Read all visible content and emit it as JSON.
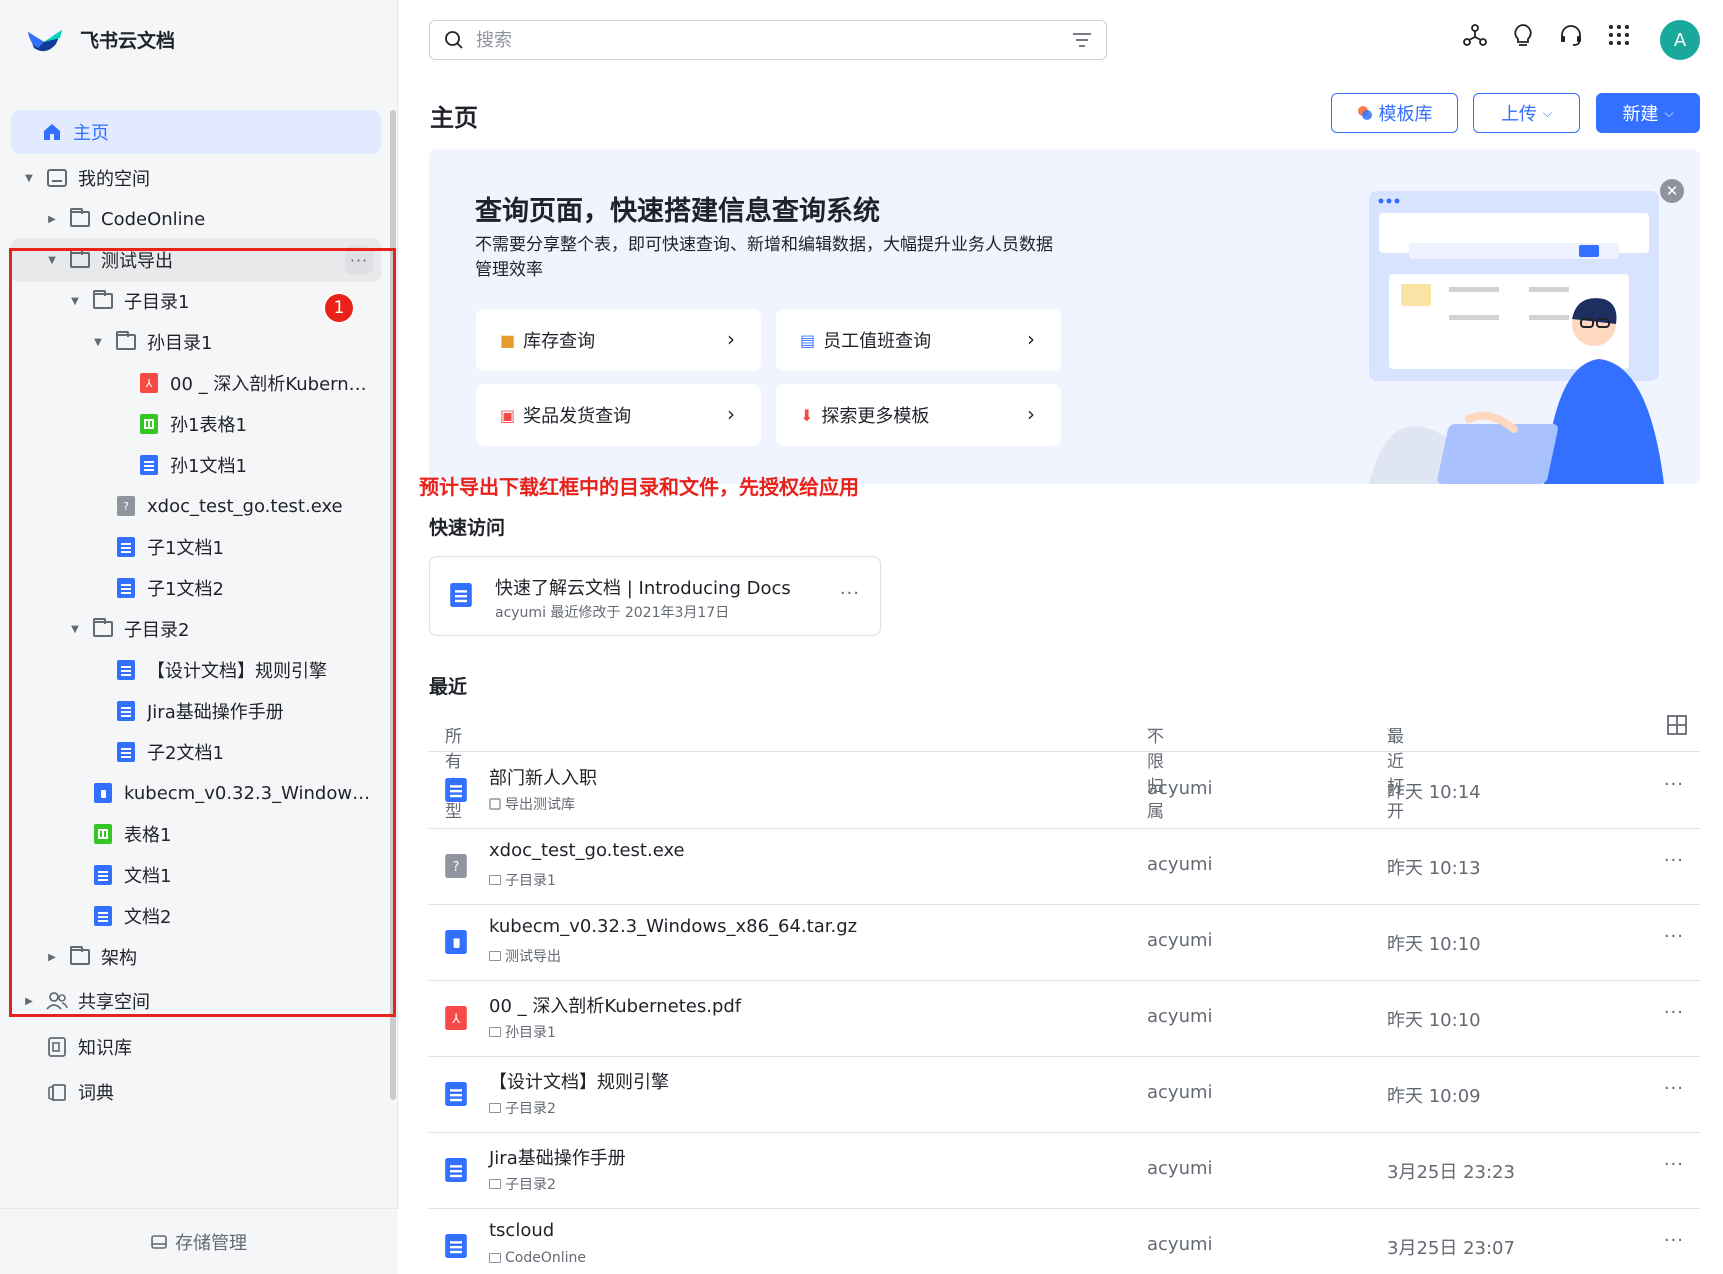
{
  "app": {
    "name": "飞书云文档"
  },
  "sidebar": {
    "home": "主页",
    "my_space": "我的空间",
    "tree": [
      {
        "label": "CodeOnline"
      },
      {
        "label": "测试导出"
      },
      {
        "label": "子目录1"
      },
      {
        "label": "孙目录1"
      },
      {
        "label": "00 _ 深入剖析Kubernet..."
      },
      {
        "label": "孙1表格1"
      },
      {
        "label": "孙1文档1"
      },
      {
        "label": "xdoc_test_go.test.exe"
      },
      {
        "label": "子1文档1"
      },
      {
        "label": "子1文档2"
      },
      {
        "label": "子目录2"
      },
      {
        "label": "【设计文档】规则引擎"
      },
      {
        "label": "Jira基础操作手册"
      },
      {
        "label": "子2文档1"
      },
      {
        "label": "kubecm_v0.32.3_Windows_x..."
      },
      {
        "label": "表格1"
      },
      {
        "label": "文档1"
      },
      {
        "label": "文档2"
      },
      {
        "label": "架构"
      }
    ],
    "shared_space": "共享空间",
    "wiki": "知识库",
    "dictionary": "词典",
    "storage": "存储管理",
    "badge": "1",
    "more_glyph": "···"
  },
  "search": {
    "placeholder": "搜索"
  },
  "user": {
    "avatar_letter": "A"
  },
  "header": {
    "title": "主页",
    "template_btn": "模板库",
    "upload_btn": "上传",
    "new_btn": "新建"
  },
  "banner": {
    "title": "查询页面，快速搭建信息查询系统",
    "desc": "不需要分享整个表，即可快速查询、新增和编辑数据，大幅提升业务人员数据管理效率",
    "tiles": [
      {
        "label": "库存查询"
      },
      {
        "label": "员工值班查询"
      },
      {
        "label": "奖品发货查询"
      },
      {
        "label": "探索更多模板"
      }
    ]
  },
  "annotation": "预计导出下载红框中的目录和文件，先授权给应用",
  "quick_access": {
    "title": "快速访问",
    "card_title": "快速了解云文档 | Introducing Docs",
    "card_sub": "acyumi 最近修改于 2021年3月17日"
  },
  "recent": {
    "title": "最近",
    "filter_type": "所有类型",
    "filter_owner": "不限归属",
    "filter_sort": "最近打开",
    "rows": [
      {
        "title": "部门新人入职",
        "location": "导出测试库",
        "owner": "acyumi",
        "time": "昨天 10:14"
      },
      {
        "title": "xdoc_test_go.test.exe",
        "location": "子目录1",
        "owner": "acyumi",
        "time": "昨天 10:13"
      },
      {
        "title": "kubecm_v0.32.3_Windows_x86_64.tar.gz",
        "location": "测试导出",
        "owner": "acyumi",
        "time": "昨天 10:10"
      },
      {
        "title": "00 _ 深入剖析Kubernetes.pdf",
        "location": "孙目录1",
        "owner": "acyumi",
        "time": "昨天 10:10"
      },
      {
        "title": "【设计文档】规则引擎",
        "location": "子目录2",
        "owner": "acyumi",
        "time": "昨天 10:09"
      },
      {
        "title": "Jira基础操作手册",
        "location": "子目录2",
        "owner": "acyumi",
        "time": "3月25日 23:23"
      },
      {
        "title": "tscloud",
        "location": "CodeOnline",
        "owner": "acyumi",
        "time": "3月25日 23:07"
      }
    ]
  },
  "colors": {
    "accent": "#3370ff",
    "annotation": "#e8221b"
  }
}
